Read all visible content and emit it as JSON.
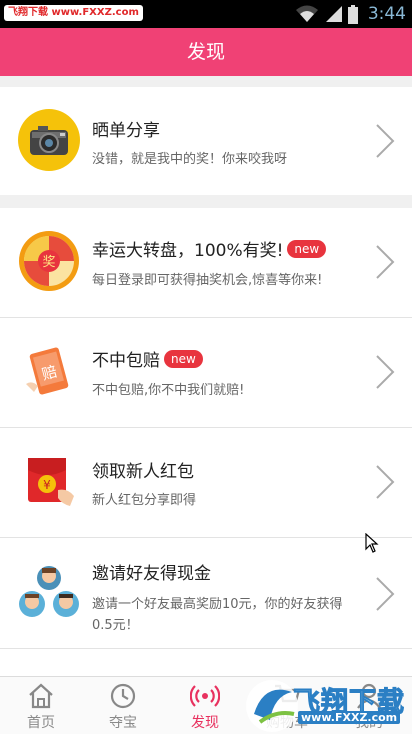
{
  "status_bar": {
    "watermark": "飞翔下载 www.FXXZ.com",
    "time": "3:44"
  },
  "header": {
    "title": "发现"
  },
  "items": [
    {
      "title": "晒单分享",
      "desc": "没错，就是我中的奖！你来咬我呀",
      "badge": ""
    },
    {
      "title": "幸运大转盘，100%有奖!",
      "desc": "每日登录即可获得抽奖机会,惊喜等你来!",
      "badge": "new"
    },
    {
      "title": "不中包赔",
      "desc": "不中包赔,你不中我们就赔!",
      "badge": "new"
    },
    {
      "title": "领取新人红包",
      "desc": "新人红包分享即得",
      "badge": ""
    },
    {
      "title": "邀请好友得现金",
      "desc": "邀请一个好友最高奖励10元，你的好友获得0.5元！",
      "badge": ""
    }
  ],
  "icon_text": {
    "wheel_prize": "奖",
    "compensate": "赔",
    "yuan": "¥"
  },
  "bottom_nav": [
    {
      "label": "首页",
      "icon": "home-icon"
    },
    {
      "label": "夺宝",
      "icon": "clock-icon"
    },
    {
      "label": "发现",
      "icon": "broadcast-icon",
      "active": true
    },
    {
      "label": "购物车",
      "icon": "cart-icon"
    },
    {
      "label": "我的",
      "icon": "user-icon"
    }
  ],
  "watermark_logo": {
    "text": "飞翔下载",
    "url": "www.FXXZ.com"
  },
  "colors": {
    "header": "#f04175",
    "active_tab": "#e8315f",
    "badge": "#e8343e"
  }
}
